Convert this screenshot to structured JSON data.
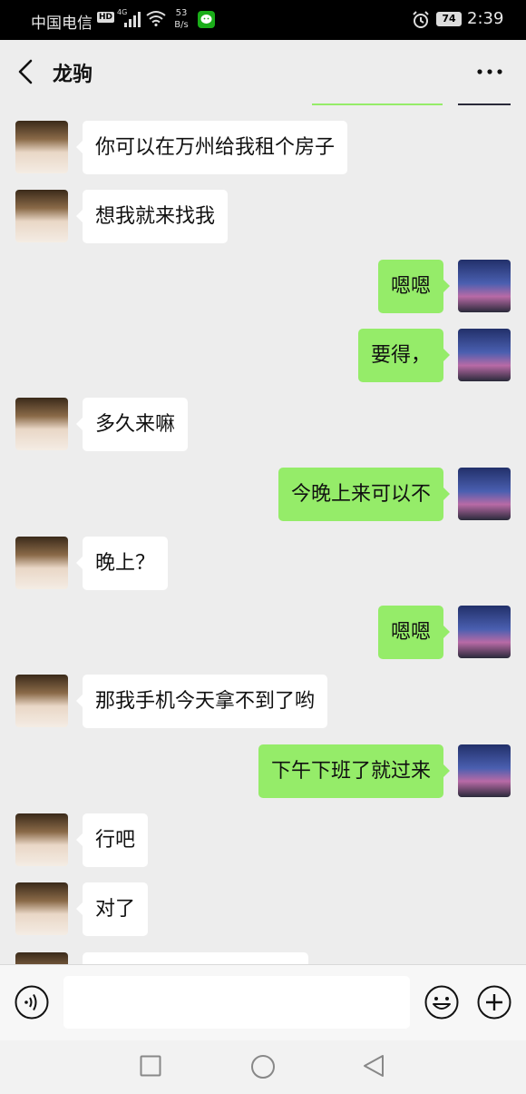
{
  "status_bar": {
    "carrier": "中国电信",
    "hd": "HD",
    "network": "4G",
    "speed_value": "53",
    "speed_unit": "B/s",
    "battery": "74",
    "time": "2:39"
  },
  "header": {
    "title": "龙驹"
  },
  "messages": [
    {
      "side": "left",
      "text": "你可以在万州给我租个房子"
    },
    {
      "side": "left",
      "text": "想我就来找我"
    },
    {
      "side": "right",
      "text": "嗯嗯"
    },
    {
      "side": "right",
      "text": "要得，"
    },
    {
      "side": "left",
      "text": "多久来嘛"
    },
    {
      "side": "right",
      "text": "今晚上来可以不"
    },
    {
      "side": "left",
      "text": "晚上？"
    },
    {
      "side": "right",
      "text": "嗯嗯"
    },
    {
      "side": "left",
      "text": "那我手机今天拿不到了哟"
    },
    {
      "side": "right",
      "text": "下午下班了就过来"
    },
    {
      "side": "left",
      "text": "行吧"
    },
    {
      "side": "left",
      "text": "对了"
    },
    {
      "side": "left",
      "text": ""
    }
  ],
  "input": {
    "value": ""
  },
  "colors": {
    "self_bubble": "#95ec69",
    "friend_bubble": "#ffffff",
    "background": "#ededed"
  }
}
